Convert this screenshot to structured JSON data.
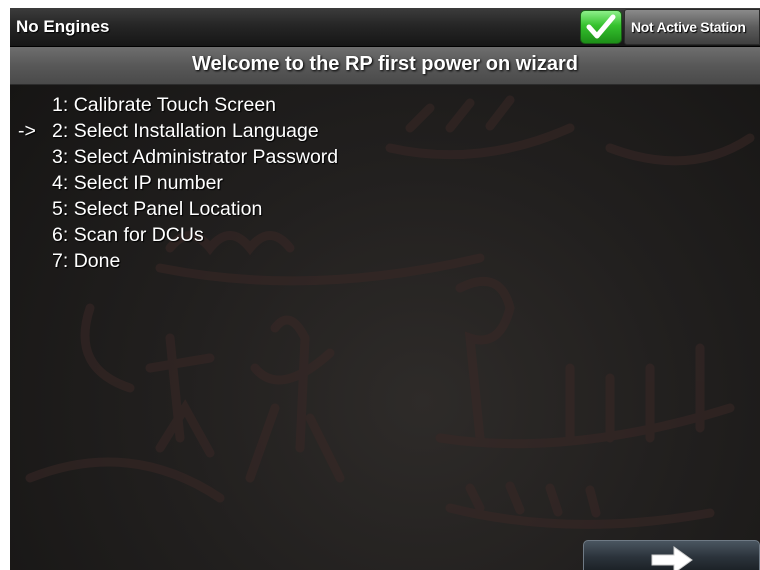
{
  "header": {
    "engines_status": "No Engines",
    "station_status": "Not Active Station",
    "status_icon": "green-checkmark-icon",
    "status_color": "#35c22e"
  },
  "wizard": {
    "title": "Welcome to the RP first power on wizard",
    "current_marker": "->",
    "current_step": 2,
    "steps": [
      {
        "number": "1:",
        "label": "Calibrate Touch Screen",
        "marker": ""
      },
      {
        "number": "2:",
        "label": "Select Installation Language",
        "marker": "->"
      },
      {
        "number": "3:",
        "label": "Select Administrator Password",
        "marker": ""
      },
      {
        "number": "4:",
        "label": "Select IP number",
        "marker": ""
      },
      {
        "number": "5:",
        "label": "Select Panel Location",
        "marker": ""
      },
      {
        "number": "6:",
        "label": "Scan for DCUs",
        "marker": ""
      },
      {
        "number": "7:",
        "label": "Done",
        "marker": ""
      }
    ]
  },
  "footer": {
    "next_icon": "right-arrow-icon"
  }
}
